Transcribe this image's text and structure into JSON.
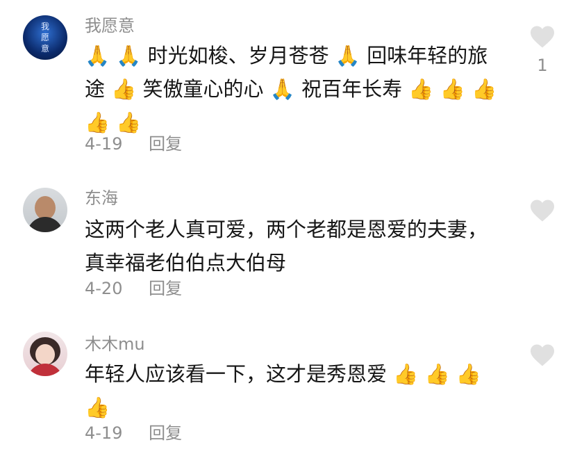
{
  "comments": [
    {
      "username": "我愿意",
      "avatar_text": "我\n愿\n意",
      "body": "🙏 🙏 时光如梭、岁月苍苍 🙏 回味年轻的旅途 👍 笑傲童心的心 🙏 祝百年长寿 👍 👍 👍 👍 👍",
      "date": "4-19",
      "reply_label": "回复",
      "like_count": "1"
    },
    {
      "username": "东海",
      "body": "这两个老人真可爱，两个老都是恩爱的夫妻，真幸福老伯伯点大伯母",
      "date": "4-20",
      "reply_label": "回复",
      "like_count": ""
    },
    {
      "username": "木木mu",
      "body": "年轻人应该看一下，这才是秀恩爱 👍 👍 👍 👍",
      "date": "4-19",
      "reply_label": "回复",
      "like_count": ""
    }
  ],
  "colors": {
    "text": "#161616",
    "muted": "#8e8e8e",
    "heart": "#e0e0e0"
  },
  "icons": [
    "heart-icon"
  ]
}
